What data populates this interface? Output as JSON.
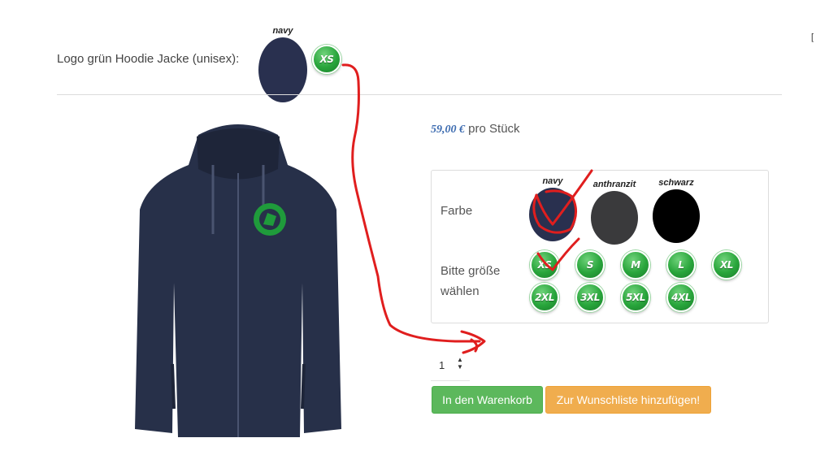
{
  "product": {
    "title": "Logo grün Hoodie Jacke (unisex):",
    "selected_color_label": "navy",
    "selected_size_label": "XS",
    "price": "59,00 €",
    "price_unit": "pro Stück"
  },
  "options": {
    "color_label": "Farbe",
    "size_label_line1": "Bitte größe",
    "size_label_line2": "wählen",
    "colors": [
      {
        "name": "navy",
        "hex": "#29304f"
      },
      {
        "name": "anthranzit",
        "hex": "#3a3a3c"
      },
      {
        "name": "schwarz",
        "hex": "#000000"
      }
    ],
    "sizes": [
      "XS",
      "S",
      "M",
      "L",
      "XL",
      "2XL",
      "3XL",
      "5XL",
      "4XL"
    ]
  },
  "quantity": "1",
  "buttons": {
    "add_to_cart": "In den Warenkorb",
    "add_to_wishlist": "Zur Wunschliste hinzufügen!"
  },
  "colors": {
    "accent_green": "#5cb85c",
    "accent_orange": "#f0ad4e",
    "price_blue": "#3c6bb0",
    "annotation_red": "#e01e1e"
  }
}
